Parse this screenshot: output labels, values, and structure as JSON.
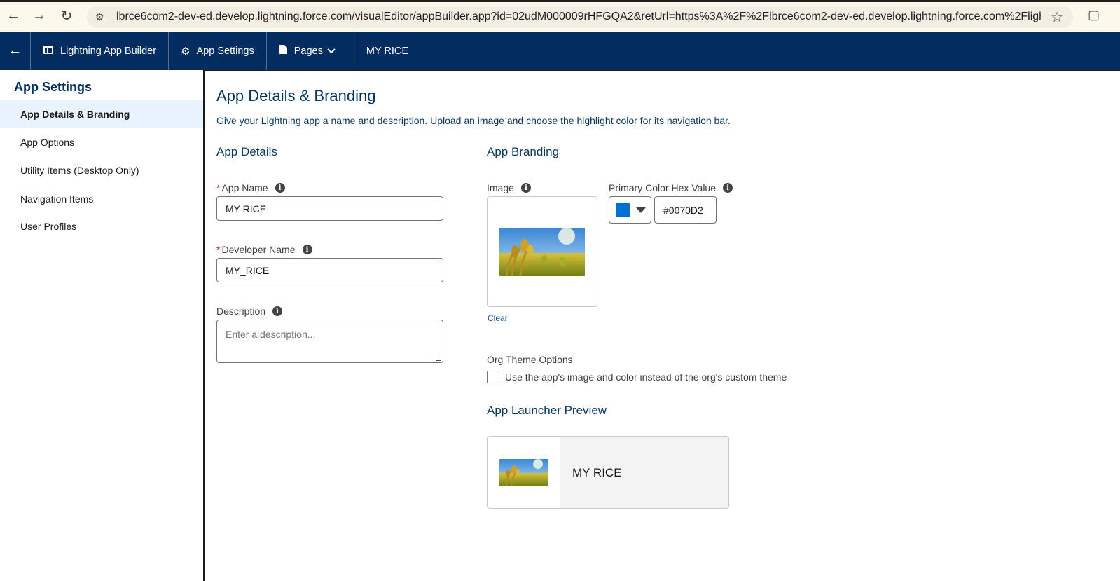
{
  "browser": {
    "url": "lbrce6com2-dev-ed.develop.lightning.force.com/visualEditor/appBuilder.app?id=02udM000009rHFGQA2&retUrl=https%3A%2F%2Flbrce6com2-dev-ed.develop.lightning.force.com%2Flightnin...",
    "icons": [
      "back-arrow-icon",
      "forward-arrow-icon",
      "reload-icon",
      "site-info-icon",
      "bookmark-star-icon",
      "extensions-icon"
    ]
  },
  "topbar": {
    "app_builder_label": "Lightning App Builder",
    "app_settings_label": "App Settings",
    "pages_label": "Pages",
    "app_title": "MY RICE",
    "background_color": "#032d60"
  },
  "sidebar": {
    "heading": "App Settings",
    "items": [
      {
        "label": "App Details & Branding",
        "active": true
      },
      {
        "label": "App Options",
        "active": false
      },
      {
        "label": "Utility Items (Desktop Only)",
        "active": false
      },
      {
        "label": "Navigation Items",
        "active": false
      },
      {
        "label": "User Profiles",
        "active": false
      }
    ]
  },
  "main": {
    "title": "App Details & Branding",
    "description": "Give your Lightning app a name and description. Upload an image and choose the highlight color for its navigation bar.",
    "app_details": {
      "heading": "App Details",
      "app_name_label": "App Name",
      "app_name_value": "MY RICE",
      "developer_name_label": "Developer Name",
      "developer_name_value": "MY_RICE",
      "description_label": "Description",
      "description_placeholder": "Enter a description..."
    },
    "app_branding": {
      "heading": "App Branding",
      "image_label": "Image",
      "clear_label": "Clear",
      "primary_color_label": "Primary Color Hex Value",
      "primary_color_value": "#0070D2",
      "org_theme_label": "Org Theme Options",
      "org_theme_checkbox_label": "Use the app's image and color instead of the org's custom theme",
      "org_theme_checked": false
    },
    "launcher_preview": {
      "heading": "App Launcher Preview",
      "app_name": "MY RICE"
    }
  }
}
